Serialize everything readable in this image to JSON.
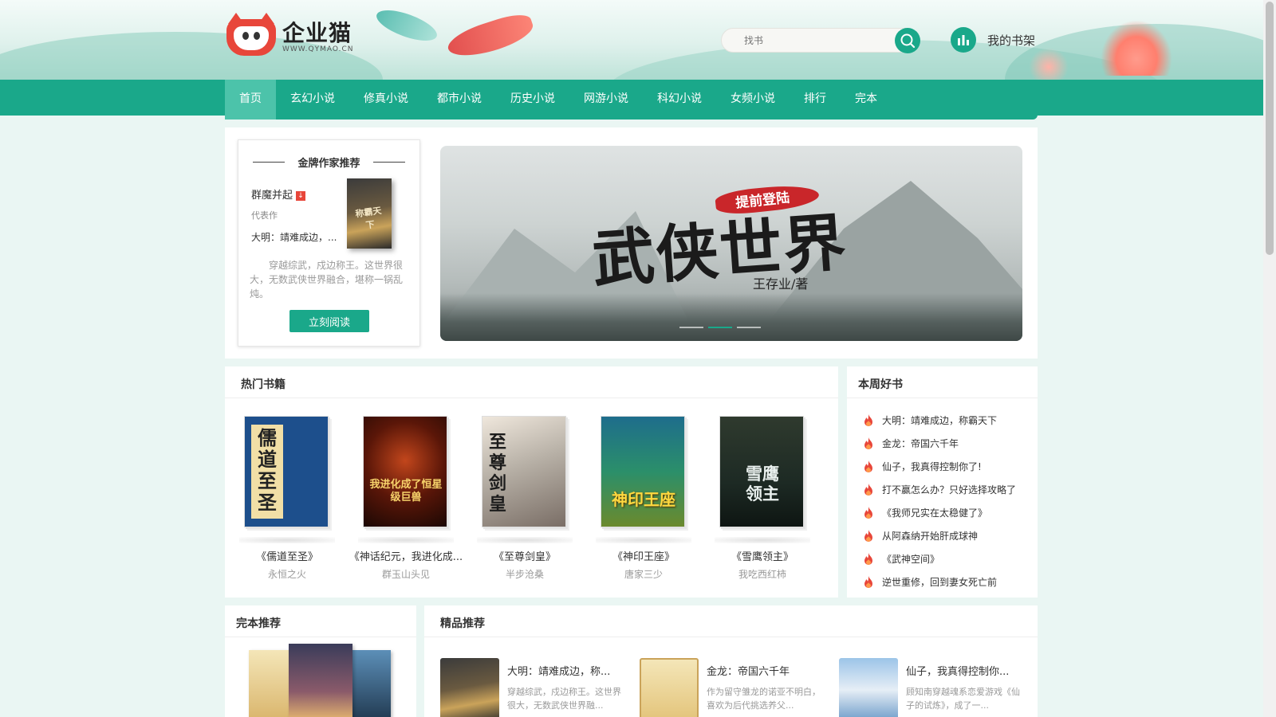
{
  "header": {
    "logo_name": "企业猫",
    "logo_url": "WWW.QYMAO.CN",
    "search_placeholder": "找书",
    "shelf_label": "我的书架"
  },
  "nav": {
    "items": [
      "首页",
      "玄幻小说",
      "修真小说",
      "都市小说",
      "历史小说",
      "网游小说",
      "科幻小说",
      "女频小说",
      "排行",
      "完本"
    ],
    "active_index": 0
  },
  "author_card": {
    "title": "金牌作家推荐",
    "author": "群魔并起",
    "rep_label": "代表作",
    "book": "大明：靖难成边，...",
    "cover_text": "称霸天下",
    "desc": "穿越综武，戍边称王。这世界很大，无数武侠世界融合，堪称一锅乱炖。",
    "button": "立刻阅读"
  },
  "banner": {
    "tag": "提前登陆",
    "title": "武侠世界",
    "author": "王存业/著",
    "slide_count": 3,
    "active_slide": 1
  },
  "hot_books": {
    "title": "热门书籍",
    "books": [
      {
        "name": "《儒道至圣》",
        "author": "永恒之火",
        "cover_text": "儒道至圣"
      },
      {
        "name": "《神话纪元，我进化成...",
        "author": "群玉山头见",
        "cover_text": "我进化成了恒星级巨兽"
      },
      {
        "name": "《至尊剑皇》",
        "author": "半步沧桑",
        "cover_text": "至尊剑皇"
      },
      {
        "name": "《神印王座》",
        "author": "唐家三少",
        "cover_text": "神印王座"
      },
      {
        "name": "《雪鹰领主》",
        "author": "我吃西红柿",
        "cover_text": "雪鹰领主"
      }
    ]
  },
  "weekly": {
    "title": "本周好书",
    "items": [
      "大明：靖难成边，称霸天下",
      "金龙：帝国六千年",
      "仙子，我真得控制你了!",
      "打不赢怎么办？只好选择攻略了",
      "《我师兄实在太稳健了》",
      "从阿森纳开始肝成球神",
      "《武神空间》",
      "逆世重修，回到妻女死亡前"
    ]
  },
  "complete": {
    "title": "完本推荐"
  },
  "premium": {
    "title": "精品推荐",
    "items": [
      {
        "name": "大明：靖难成边，称...",
        "desc": "穿越综武，戍边称王。这世界很大，无数武侠世界融..."
      },
      {
        "name": "金龙：帝国六千年",
        "desc": "作为留守雏龙的诺亚不明白，喜欢为后代挑选养父..."
      },
      {
        "name": "仙子，我真得控制你...",
        "desc": "顾知南穿越魂系恋爱游戏《仙子的试炼》，成了一..."
      }
    ]
  },
  "colors": {
    "accent": "#1aa88a",
    "nav_active": "#4cc3aa",
    "page_bg": "#eaf6f3",
    "hot_icon": "#e8463a"
  }
}
